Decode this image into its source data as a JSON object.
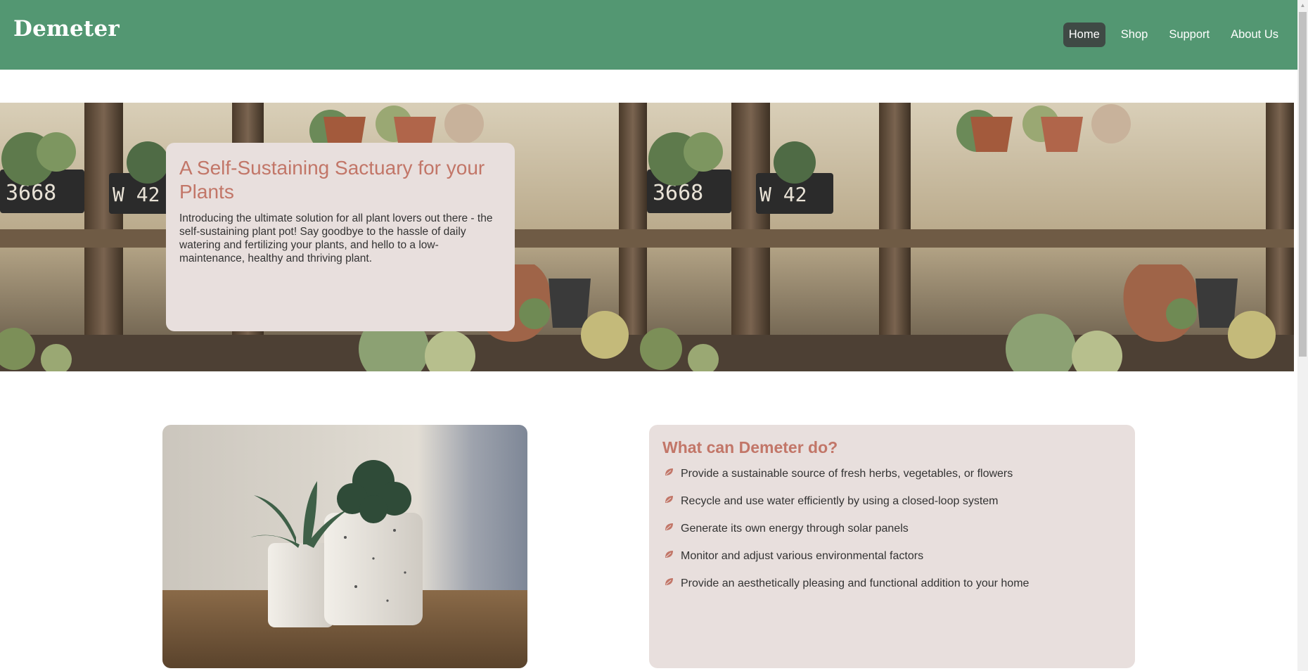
{
  "header": {
    "logo": "Demeter",
    "nav": [
      {
        "label": "Home",
        "active": true
      },
      {
        "label": "Shop",
        "active": false
      },
      {
        "label": "Support",
        "active": false
      },
      {
        "label": "About Us",
        "active": false
      }
    ]
  },
  "hero": {
    "title": "A Self-Sustaining Sactuary for your Plants",
    "text": "Introducing the ultimate solution for all plant lovers out there - the self-sustaining plant pot! Say goodbye to the hassle of daily watering and fertilizing your plants, and hello to a low-maintenance, healthy and thriving plant."
  },
  "features": {
    "title": "What can Demeter do?",
    "items": [
      "Provide a sustainable source of fresh herbs, vegetables, or flowers",
      "Recycle and use water efficiently by using a closed-loop system",
      "Generate its own energy through solar panels",
      "Monitor and adjust various environmental factors",
      "Provide an aesthetically pleasing and functional addition to your home"
    ]
  },
  "colors": {
    "header_bg": "#539772",
    "active_nav_bg": "#3f4a45",
    "card_bg": "#e8dfdd",
    "accent": "#c27668"
  },
  "icons": {
    "list_bullet": "leaf-icon"
  }
}
